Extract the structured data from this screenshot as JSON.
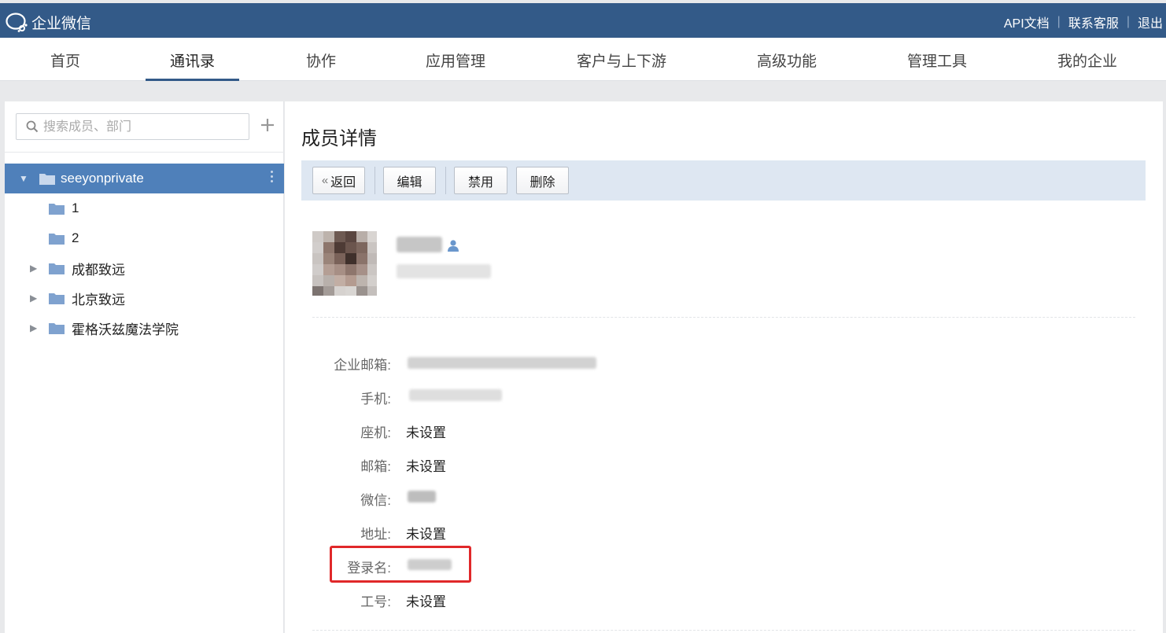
{
  "app": {
    "name": "企业微信",
    "links": [
      "API文档",
      "联系客服",
      "退出"
    ]
  },
  "nav": {
    "tabs": [
      "首页",
      "通讯录",
      "协作",
      "应用管理",
      "客户与上下游",
      "高级功能",
      "管理工具",
      "我的企业"
    ],
    "active": "通讯录"
  },
  "sidebar": {
    "search_placeholder": "搜索成员、部门",
    "tree": [
      {
        "label": "seeyonprivate",
        "expanded": true,
        "selected": true
      },
      {
        "label": "1"
      },
      {
        "label": "2"
      },
      {
        "label": "成都致远",
        "collapsed": true
      },
      {
        "label": "北京致远",
        "collapsed": true
      },
      {
        "label": "霍格沃兹魔法学院",
        "collapsed": true
      }
    ]
  },
  "main": {
    "title": "成员详情",
    "toolbar": {
      "back": "返回",
      "edit": "编辑",
      "disable": "禁用",
      "delete": "删除"
    },
    "fields": [
      {
        "label": "企业邮箱:",
        "value": ""
      },
      {
        "label": "手机:",
        "value": ""
      },
      {
        "label": "座机:",
        "value": "未设置"
      },
      {
        "label": "邮箱:",
        "value": "未设置"
      },
      {
        "label": "微信:",
        "value": ""
      },
      {
        "label": "地址:",
        "value": "未设置"
      },
      {
        "label": "登录名:",
        "value": ""
      },
      {
        "label": "工号:",
        "value": "未设置"
      }
    ]
  },
  "colors": {
    "topbar": "#335a88",
    "selected": "#4f80ba",
    "toolbar_bg": "#dee7f2",
    "highlight": "#e0282a"
  }
}
